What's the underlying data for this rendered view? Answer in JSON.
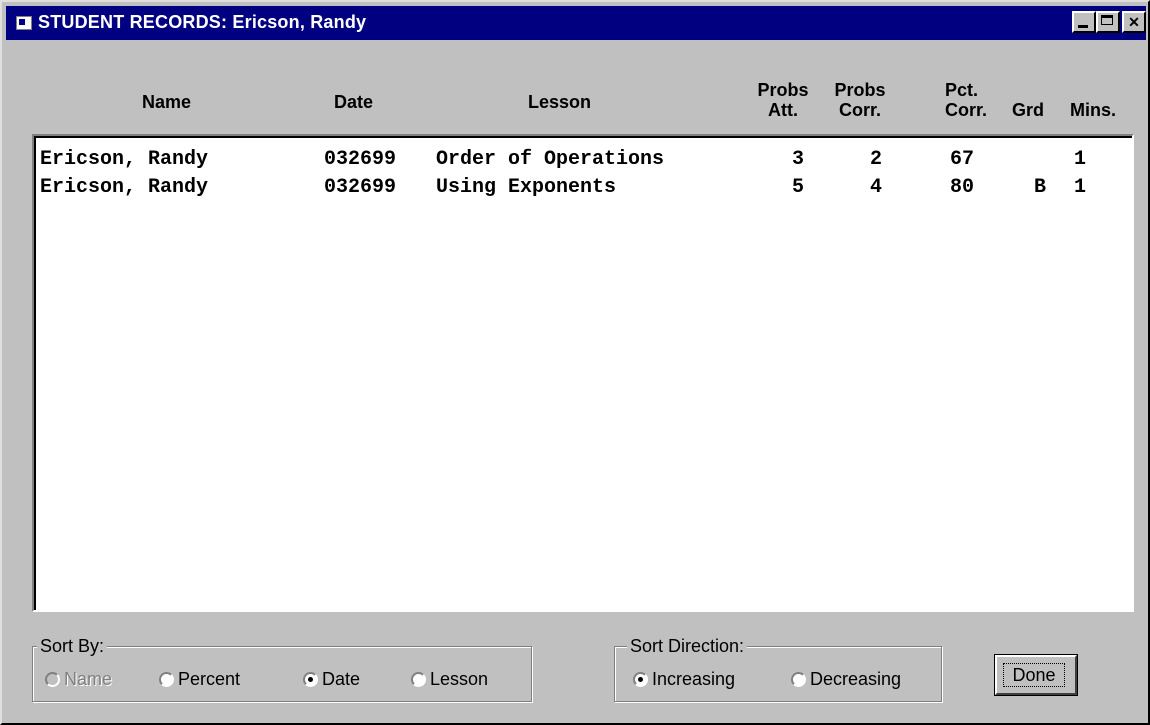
{
  "window": {
    "title": "STUDENT RECORDS: Ericson, Randy"
  },
  "columns": {
    "name": "Name",
    "date": "Date",
    "lesson": "Lesson",
    "probs_att": [
      "Probs",
      "Att."
    ],
    "probs_corr": [
      "Probs",
      "Corr."
    ],
    "pct_corr": [
      "Pct.",
      "Corr."
    ],
    "grd": "Grd",
    "mins": "Mins."
  },
  "records": [
    {
      "name": "Ericson, Randy",
      "date": "032699",
      "lesson": "Order of Operations",
      "probs_att": "3",
      "probs_corr": "2",
      "pct_corr": "67",
      "grd": "",
      "mins": "1"
    },
    {
      "name": "Ericson, Randy",
      "date": "032699",
      "lesson": "Using Exponents",
      "probs_att": "5",
      "probs_corr": "4",
      "pct_corr": "80",
      "grd": "B",
      "mins": "1"
    }
  ],
  "sort_by": {
    "legend": "Sort By:",
    "options": [
      "Name",
      "Percent",
      "Date",
      "Lesson"
    ],
    "selected": "Date",
    "disabled": [
      "Name"
    ]
  },
  "sort_direction": {
    "legend": "Sort Direction:",
    "options": [
      "Increasing",
      "Decreasing"
    ],
    "selected": "Increasing"
  },
  "buttons": {
    "done": "Done"
  }
}
